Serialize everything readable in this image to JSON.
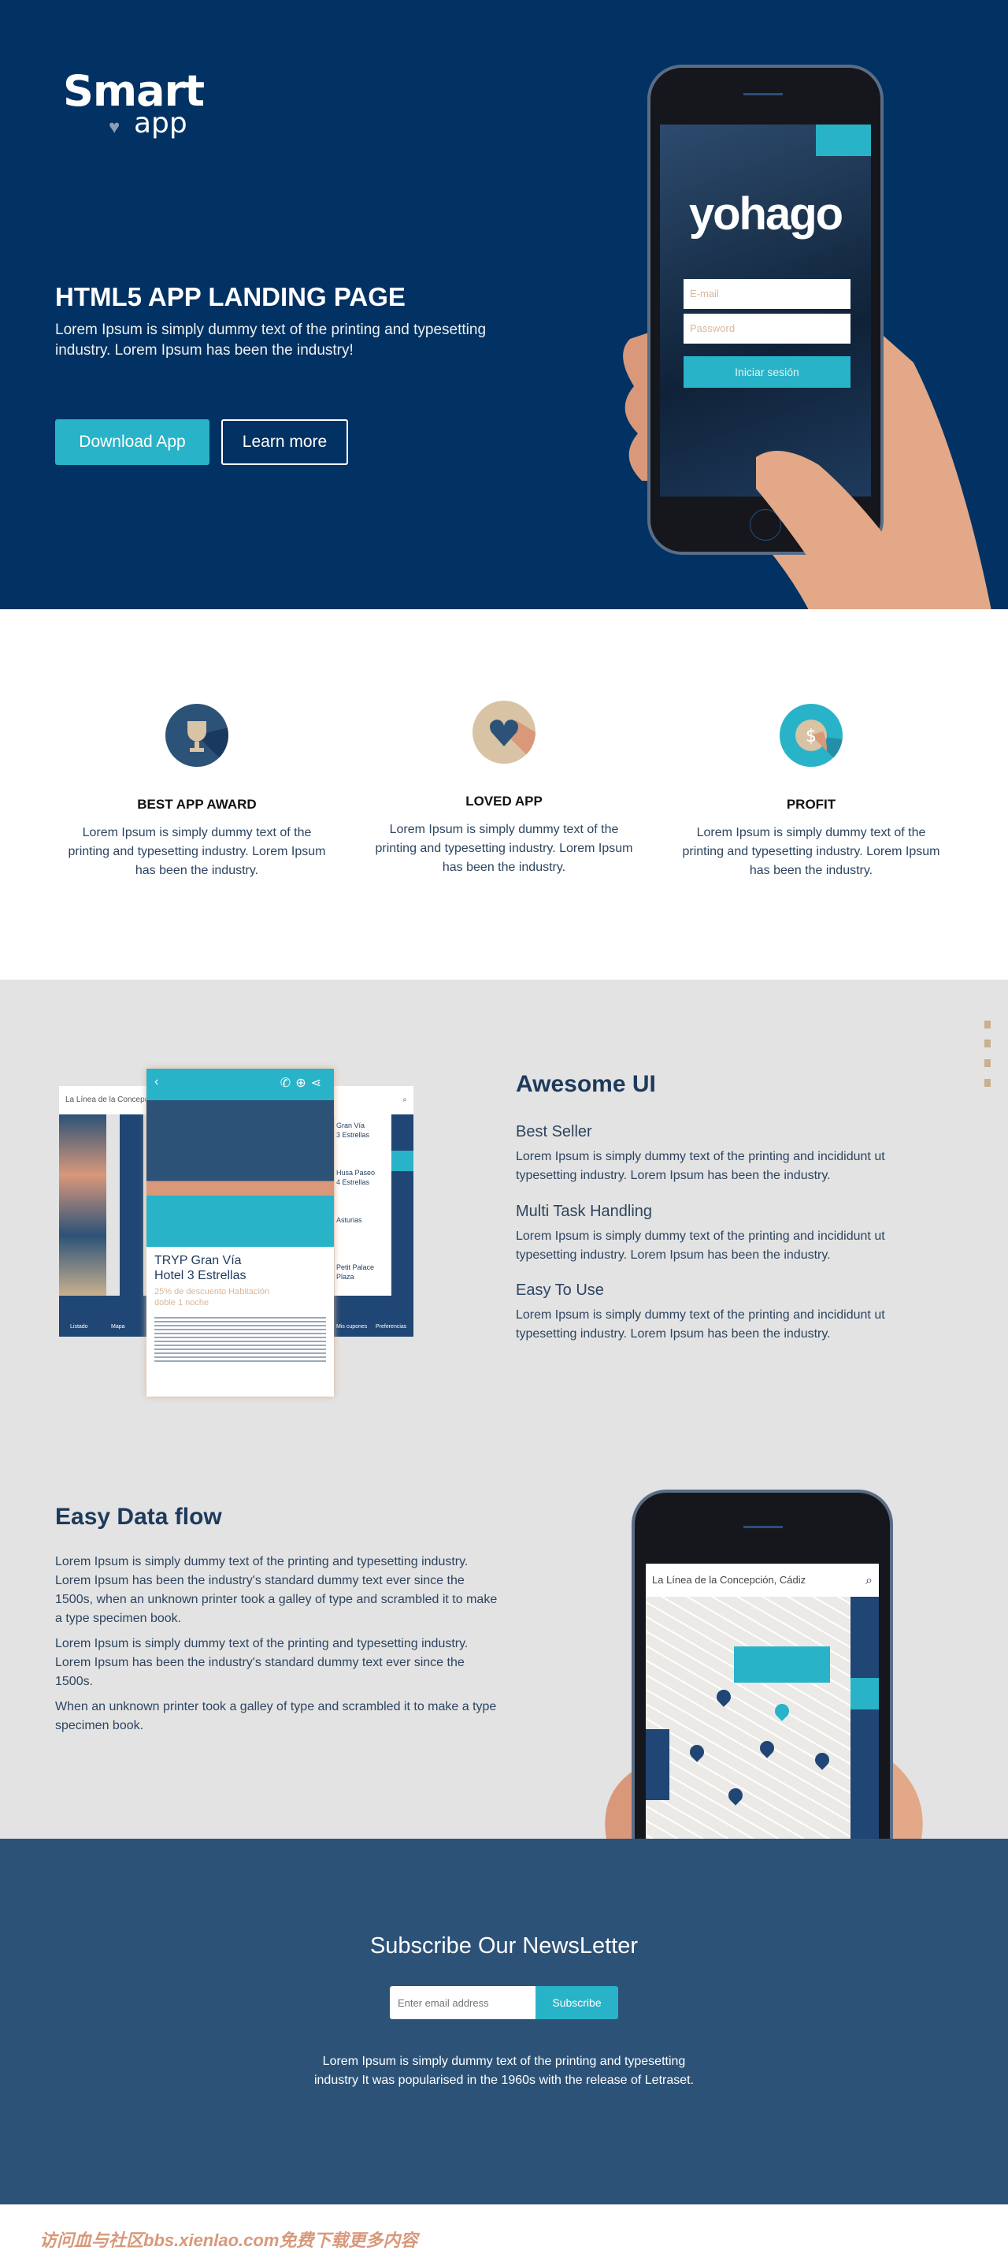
{
  "hero": {
    "logo_main": "Smart",
    "logo_sub": "app",
    "title": "HTML5 APP LANDING PAGE",
    "text": "Lorem Ipsum is simply dummy text of the printing and typesetting industry. Lorem Ipsum has been the industry!",
    "download_label": "Download App",
    "learn_label": "Learn more",
    "phone": {
      "brand": "yohago",
      "email_placeholder": "E-mail",
      "password_placeholder": "Password",
      "login_label": "Iniciar sesión"
    }
  },
  "features": [
    {
      "icon": "trophy-icon",
      "title": "BEST APP AWARD",
      "text": "Lorem Ipsum is simply dummy text of the printing and typesetting industry. Lorem Ipsum has been the industry."
    },
    {
      "icon": "heart-icon",
      "title": "LOVED APP",
      "text": "Lorem Ipsum is simply dummy text of the printing and typesetting industry. Lorem Ipsum has been the industry."
    },
    {
      "icon": "dollar-icon",
      "title": "PROFIT",
      "text": "Lorem Ipsum is simply dummy text of the printing and typesetting industry. Lorem Ipsum has been the industry."
    }
  ],
  "awesome": {
    "title": "Awesome UI",
    "items": [
      {
        "title": "Best Seller",
        "text": "Lorem Ipsum is simply dummy text of the printing and incididunt ut typesetting industry. Lorem Ipsum has been the industry."
      },
      {
        "title": "Multi Task Handling",
        "text": "Lorem Ipsum is simply dummy text of the printing and incididunt ut typesetting industry. Lorem Ipsum has been the industry."
      },
      {
        "title": "Easy To Use",
        "text": "Lorem Ipsum is simply dummy text of the printing and incididunt ut typesetting industry. Lorem Ipsum has been the industry."
      }
    ],
    "mockup": {
      "search_text": "La Línea de la Concepción, Cádiz",
      "hotel_name": "TRYP Gran Vía",
      "hotel_stars": "Hotel 3 Estrellas",
      "offer": "25% de descuento Habitación doble 1 noche",
      "tab_list": "Listado",
      "tab_map": "Mapa",
      "tab_coupons": "Mis cupones",
      "tab_prefs": "Preferencias"
    }
  },
  "dataflow": {
    "title": "Easy Data flow",
    "paragraphs": [
      "Lorem Ipsum is simply dummy text of the printing and typesetting industry. Lorem Ipsum has been the industry's standard dummy text ever since the 1500s, when an unknown printer took a galley of type and scrambled it to make a type specimen book.",
      "Lorem Ipsum is simply dummy text of the printing and typesetting industry. Lorem Ipsum has been the industry's standard dummy text ever since the 1500s.",
      "When an unknown printer took a galley of type and scrambled it to make a type specimen book."
    ],
    "phone_search": "La Línea de la Concepción, Cádiz"
  },
  "newsletter": {
    "title": "Subscribe Our NewsLetter",
    "placeholder": "Enter email address",
    "button": "Subscribe",
    "text": "Lorem Ipsum is simply dummy text of the printing and typesetting industry It was popularised in the 1960s with the release of Letraset."
  },
  "footer": {
    "watermark": "访问血与社区bbs.xienlao.com免费下载更多内容"
  },
  "colors": {
    "hero_bg": "#023263",
    "accent": "#29b3c8",
    "section_gray": "#e3e3e3",
    "newsletter_bg": "#2c5278",
    "tan": "#d9c3a5"
  }
}
